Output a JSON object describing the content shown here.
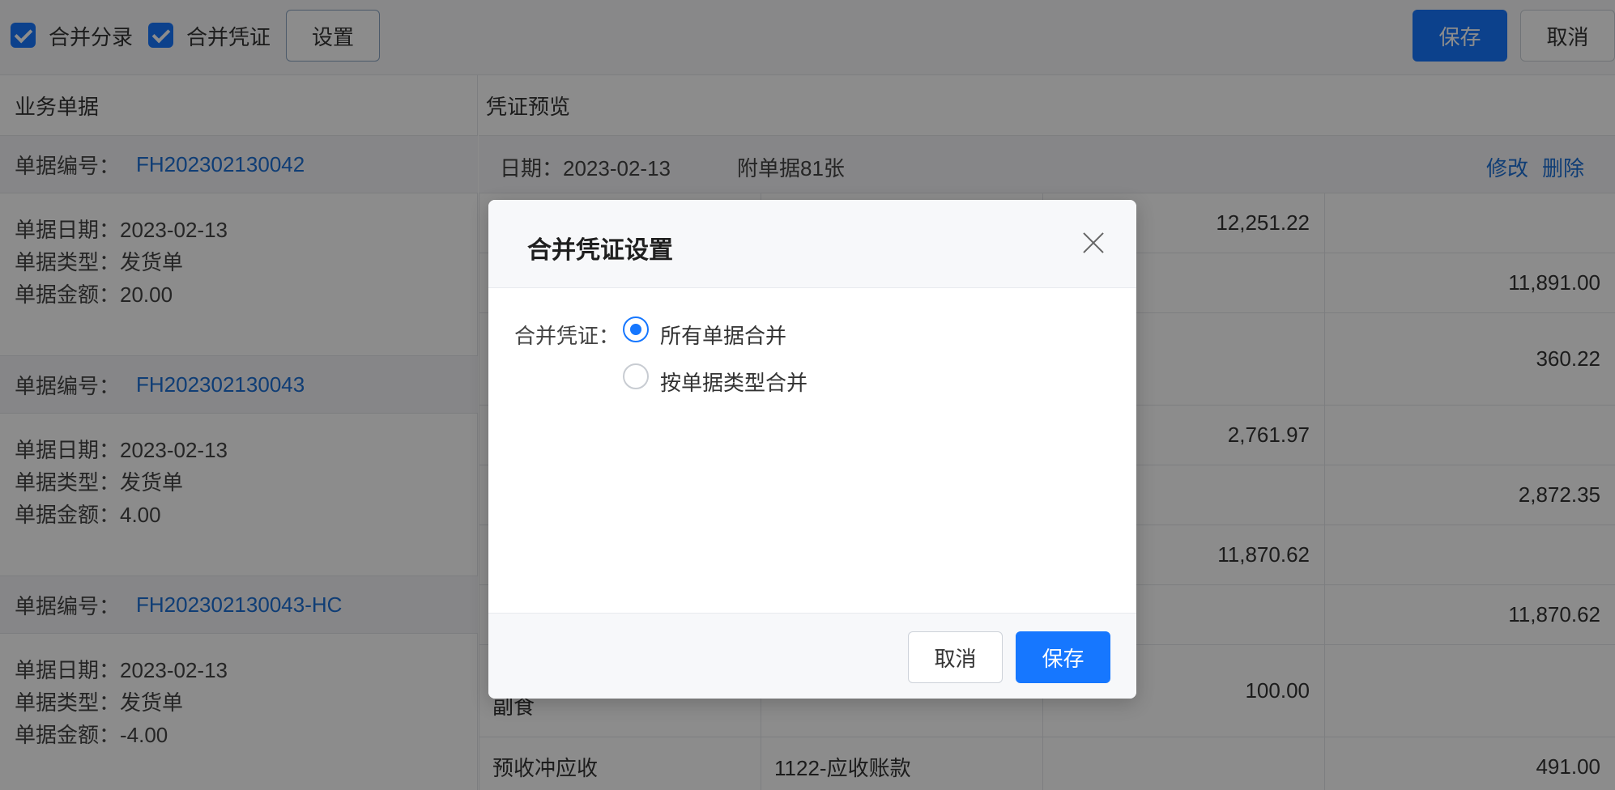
{
  "toolbar": {
    "merge_entries_label": "合并分录",
    "merge_vouchers_label": "合并凭证",
    "settings_label": "设置",
    "save_label": "保存",
    "cancel_label": "取消"
  },
  "left_panel": {
    "title": "业务单据",
    "doc_no_label": "单据编号：",
    "documents": [
      {
        "no": "FH202302130042",
        "date_line": "单据日期：2023-02-13",
        "type_line": "单据类型：发货单",
        "amount_line": "单据金额：20.00"
      },
      {
        "no": "FH202302130043",
        "date_line": "单据日期：2023-02-13",
        "type_line": "单据类型：发货单",
        "amount_line": "单据金额：4.00"
      },
      {
        "no": "FH202302130043-HC",
        "date_line": "单据日期：2023-02-13",
        "type_line": "单据类型：发货单",
        "amount_line": "单据金额：-4.00"
      }
    ]
  },
  "right_panel": {
    "title": "凭证预览",
    "voucher_date": "日期：2023-02-13",
    "attachments": "附单据81张",
    "edit_label": "修改",
    "delete_label": "删除",
    "rows": [
      {
        "summary": "",
        "account": "",
        "debit": "12,251.22",
        "credit": ""
      },
      {
        "summary": "",
        "account": "",
        "debit": "",
        "credit": "11,891.00"
      },
      {
        "summary": "",
        "account": "",
        "debit": "",
        "credit": "360.22"
      },
      {
        "summary": "",
        "account": "",
        "debit": "2,761.97",
        "credit": ""
      },
      {
        "summary": "",
        "account": "",
        "debit": "",
        "credit": "2,872.35"
      },
      {
        "summary": "",
        "account": "",
        "debit": "11,870.62",
        "credit": ""
      },
      {
        "summary": "",
        "account": "",
        "debit": "",
        "credit": "11,870.62"
      },
      {
        "summary": "副食",
        "account": "",
        "debit": "100.00",
        "credit": ""
      },
      {
        "summary": "预收冲应收",
        "account": "1122-应收账款",
        "debit": "",
        "credit": "491.00"
      }
    ]
  },
  "modal": {
    "title": "合并凭证设置",
    "field_label": "合并凭证：",
    "options": [
      {
        "label": "所有单据合并",
        "selected": true
      },
      {
        "label": "按单据类型合并",
        "selected": false
      }
    ],
    "cancel_label": "取消",
    "save_label": "保存"
  },
  "colors": {
    "primary": "#1677ff",
    "link": "#1c6fd6",
    "mask": "rgba(0,0,0,0.45)"
  }
}
